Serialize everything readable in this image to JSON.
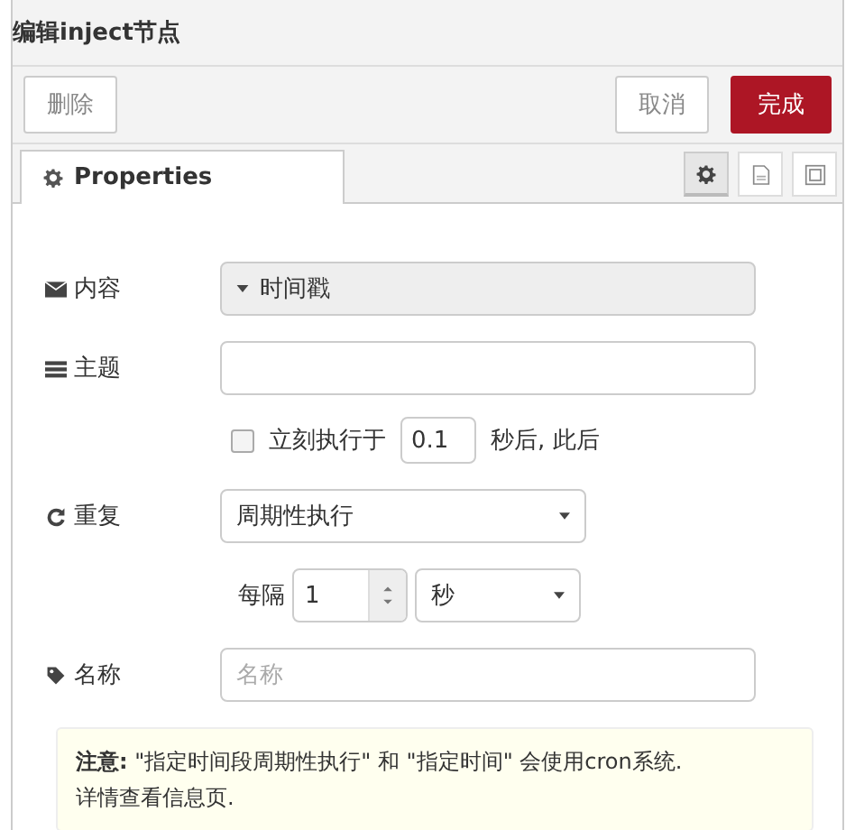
{
  "window": {
    "title": "编辑inject节点"
  },
  "buttons": [
    {
      "label": "删除",
      "kind": "plain"
    },
    {
      "label": "取消",
      "kind": "plain"
    },
    {
      "label": "完成",
      "kind": "primary"
    }
  ],
  "tabs": [
    {
      "label": "Properties",
      "selected": true
    }
  ],
  "tab_tools": [
    {
      "kind": "gear",
      "selected": true
    },
    {
      "kind": "doc",
      "selected": false
    },
    {
      "kind": "frame",
      "selected": false
    }
  ],
  "form": {
    "payload": {
      "label": "内容",
      "value": "时间戳",
      "disabled": true
    },
    "topic": {
      "label": "主题"
    },
    "inject_once": {
      "label": "立刻执行于",
      "checked": false,
      "delay": "0.1",
      "suffix": "秒后, 此后"
    },
    "repeat": {
      "label": "重复",
      "value": "周期性执行"
    },
    "interval": {
      "label": "每隔",
      "value": "1",
      "unit": "秒"
    },
    "name": {
      "label": "名称",
      "placeholder": "名称"
    }
  },
  "note": {
    "lines": [
      "**注意:** \"指定时间段周期性执行\" 和 \"指定时间\" 会使用cron系统.",
      "详情查看信息页."
    ]
  }
}
